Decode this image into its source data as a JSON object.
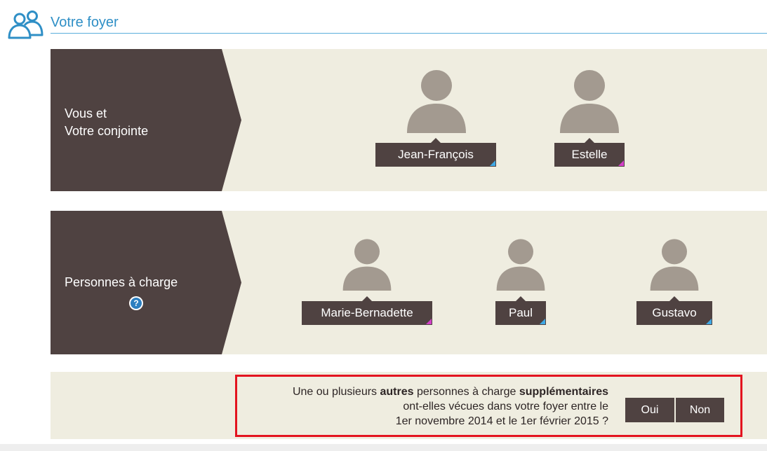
{
  "header": {
    "title": "Votre foyer",
    "icon": "household-icon"
  },
  "household": {
    "label_line1": "Vous et",
    "label_line2": "Votre conjointe",
    "members": [
      "Jean-François",
      "Estelle"
    ]
  },
  "dependents": {
    "label": "Personnes à charge",
    "help_icon": "?",
    "members": [
      "Marie-Bernadette",
      "Paul",
      "Gustavo"
    ]
  },
  "question": {
    "p1": "Une ou plusieurs ",
    "b1": "autres",
    "p2": " personnes à charge ",
    "b2": "supplémentaires",
    "line2": "ont-elles vécues dans votre foyer entre le",
    "line3": "1er novembre 2014 et le 1er février 2015 ?",
    "yes_label": "Oui",
    "no_label": "Non"
  },
  "colors": {
    "accent_blue": "#2f8fc6",
    "panel_bg": "#efede0",
    "dark_brown": "#4f4241",
    "silhouette": "#a39a90",
    "highlight_red": "#e3141f",
    "corner_blue": "#3fa9e6",
    "corner_pink": "#d43fc9"
  }
}
